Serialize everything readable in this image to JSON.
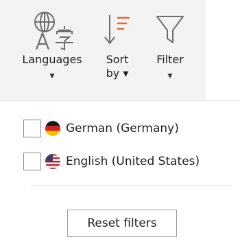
{
  "toolbar": {
    "languages": {
      "label": "Languages",
      "caret": "▼",
      "icon": "translate-icon"
    },
    "sort": {
      "label_line1": "Sort",
      "label_line2": "by ▾",
      "icon": "sort-descending-icon"
    },
    "filter": {
      "label": "Filter",
      "caret": "▼",
      "icon": "filter-icon"
    }
  },
  "filter_panel": {
    "items": [
      {
        "label": "German (Germany)",
        "checked": false,
        "flag": "germany-flag-icon"
      },
      {
        "label": "English (United States)",
        "checked": false,
        "flag": "us-flag-icon"
      }
    ],
    "reset_label": "Reset filters"
  },
  "colors": {
    "ribbon_bg": "#f3f3f3",
    "sort_accent": "#e8663d",
    "icon_gray": "#6d6d6d"
  }
}
